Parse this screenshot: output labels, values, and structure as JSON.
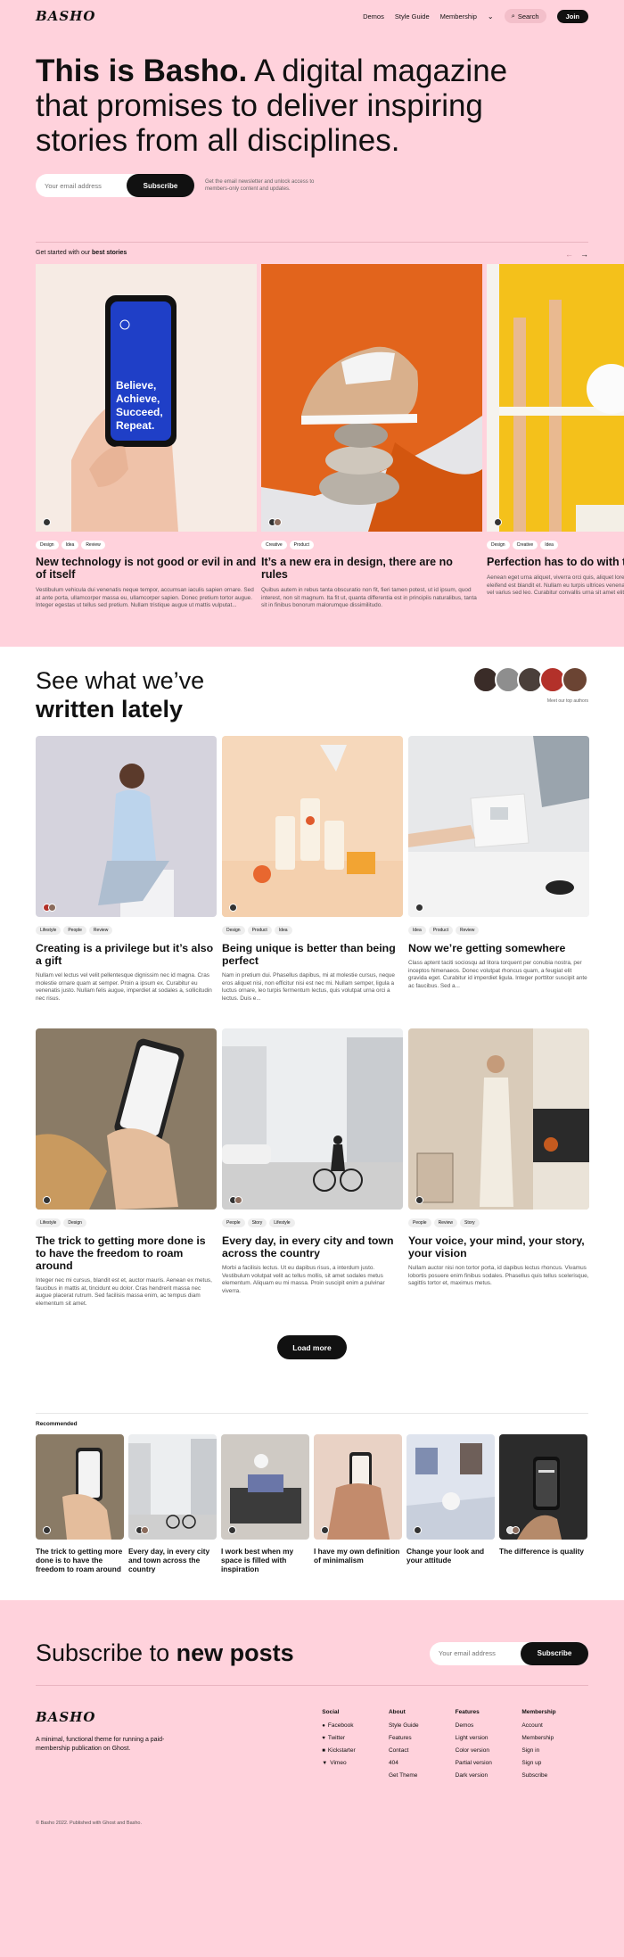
{
  "header": {
    "logo": "BASHO",
    "nav": [
      "Demos",
      "Style Guide",
      "Membership"
    ],
    "chevron_glyph": "⌄",
    "search_label": "Search",
    "search_glyph": "⌕",
    "join_label": "Join"
  },
  "hero": {
    "headline_bold": "This is Basho.",
    "headline_rest": " A digital magazine that promises to deliver inspiring stories from all disciplines.",
    "email_placeholder": "Your email address",
    "subscribe_label": "Subscribe",
    "note": "Get the email newsletter and unlock access to members-only content and updates."
  },
  "best": {
    "prefix": "Get started with our ",
    "bold": "best stories",
    "prev": "←",
    "next": "→",
    "cards": [
      {
        "tags": [
          "Design",
          "Idea",
          "Review"
        ],
        "title": "New technology is not good or evil in and of itself",
        "excerpt": "Vestibulum vehicula dui venenatis neque tempor, accumsan iaculis sapien ornare. Sed at ante porta, ullamcorper massa eu, ullamcorper sapien. Donec pretium tortor augue. Integer egestas ut tellus sed pretium. Nullam tristique augue ut mattis vulputat..."
      },
      {
        "tags": [
          "Creative",
          "Product"
        ],
        "title": "It’s a new era in design, there are no rules",
        "excerpt": "Quibus autem in rebus tanta obscuratio non fit, fieri tamen potest, ut id ipsum, quod interest, non sit magnum. Ita fit ut, quanta differentia est in principiis naturalibus, tanta sit in finibus bonorum malorumque dissimilitudo."
      },
      {
        "tags": [
          "Design",
          "Creative",
          "Idea"
        ],
        "title": "Perfection has to do with the end product",
        "excerpt": "Aenean eget urna aliquet, viverra orci quis, aliquet lorem. Ut rutrum quam eu, eu eleifend est blandit et. Nullam eu turpis ultrices venenatis. Aliquam massa ipsum, porta vel varius sed leo. Curabitur convallis urna sit amet elit..."
      }
    ],
    "phone_text": "Believe, Achieve, Succeed, Repeat."
  },
  "latest": {
    "title_1": "See what we’ve",
    "title_2": "written lately",
    "authors_note": "Meet our top authors",
    "cards": [
      {
        "tags": [
          "Lifestyle",
          "People",
          "Review"
        ],
        "title": "Creating is a privilege but it’s also a gift",
        "excerpt": "Nullam vel lectus vel velit pellentesque dignissim nec id magna. Cras molestie ornare quam at semper. Proin a ipsum ex. Curabitur eu venenatis justo. Nullam felis augue, imperdiet at sodales a, sollicitudin nec risus."
      },
      {
        "tags": [
          "Design",
          "Product",
          "Idea"
        ],
        "title": "Being unique is better than being perfect",
        "excerpt": "Nam in pretium dui. Phasellus dapibus, mi at molestie cursus, neque eros aliquet nisi, non efficitur nisi est nec mi. Nullam semper, ligula a luctus ornare, leo turpis fermentum lectus, quis volutpat urna orci a lectus. Duis e..."
      },
      {
        "tags": [
          "Idea",
          "Product",
          "Review"
        ],
        "title": "Now we’re getting somewhere",
        "excerpt": "Class aptent taciti sociosqu ad litora torquent per conubia nostra, per inceptos himenaeos. Donec volutpat rhoncus quam, a feugiat elit gravida eget. Curabitur id imperdiet ligula. Integer porttitor suscipit ante ac faucibus. Sed a..."
      },
      {
        "tags": [
          "Lifestyle",
          "Design"
        ],
        "title": "The trick to getting more done is to have the freedom to roam around",
        "excerpt": "Integer nec mi cursus, blandit est et, auctor mauris. Aenean ex metus, faucibus in mattis at, tincidunt eu dolor. Cras hendrerit massa nec augue placerat rutrum. Sed facilisis massa enim, ac tempus diam elementum sit amet."
      },
      {
        "tags": [
          "People",
          "Story",
          "Lifestyle"
        ],
        "title": "Every day, in every city and town across the country",
        "excerpt": "Morbi a facilisis lectus. Ut eu dapibus risus, a interdum justo. Vestibulum volutpat velit ac tellus mollis, sit amet sodales metus elementum. Aliquam eu mi massa. Proin suscipit enim a pulvinar viverra."
      },
      {
        "tags": [
          "People",
          "Review",
          "Story"
        ],
        "title": "Your voice, your mind, your story, your vision",
        "excerpt": "Nullam auctor nisi non tortor porta, id dapibus lectus rhoncus. Vivamus lobortis posuere enim finibus sodales. Phasellus quis tellus scelerisque, sagittis tortor et, maximus metus."
      }
    ],
    "load_more": "Load more"
  },
  "recommended": {
    "heading": "Recommended",
    "items": [
      "The trick to getting more done is to have the freedom to roam around",
      "Every day, in every city and town across the country",
      "I work best when my space is filled with inspiration",
      "I have my own definition of minimalism",
      "Change your look and your attitude",
      "The difference is quality"
    ]
  },
  "subscribe": {
    "title_plain": "Subscribe to ",
    "title_bold": "new posts",
    "placeholder": "Your email address",
    "button": "Subscribe"
  },
  "footer": {
    "logo": "BASHO",
    "desc": "A minimal, functional theme for running a paid-membership publication on Ghost.",
    "social_title": "Social",
    "social": [
      {
        "label": "Facebook",
        "icon": "●"
      },
      {
        "label": "Twitter",
        "icon": "♥"
      },
      {
        "label": "Kickstarter",
        "icon": "■"
      },
      {
        "label": "Vimeo",
        "icon": "▼"
      }
    ],
    "about_title": "About",
    "about": [
      "Style Guide",
      "Features",
      "Contact",
      "404",
      "Get Theme"
    ],
    "features_title": "Features",
    "features": [
      "Demos",
      "Light version",
      "Color version",
      "Partial version",
      "Dark version"
    ],
    "membership_title": "Membership",
    "membership": [
      "Account",
      "Membership",
      "Sign in",
      "Sign up",
      "Subscribe"
    ],
    "copyright": "© Basho 2022. Published with Ghost and Basho."
  },
  "colors": {
    "pink": "#ffd2dc",
    "dark": "#111111"
  }
}
